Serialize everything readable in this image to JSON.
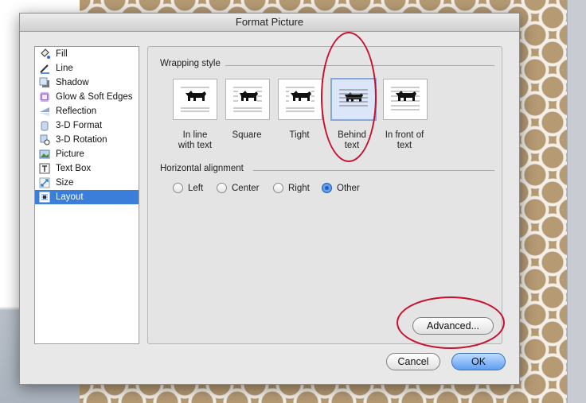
{
  "dialog": {
    "title": "Format Picture"
  },
  "sidebar": {
    "items": [
      {
        "label": "Fill",
        "icon": "fill-bucket-icon"
      },
      {
        "label": "Line",
        "icon": "line-pen-icon"
      },
      {
        "label": "Shadow",
        "icon": "shadow-icon"
      },
      {
        "label": "Glow & Soft Edges",
        "icon": "glow-icon"
      },
      {
        "label": "Reflection",
        "icon": "reflection-icon"
      },
      {
        "label": "3-D Format",
        "icon": "3d-format-icon"
      },
      {
        "label": "3-D Rotation",
        "icon": "3d-rotation-icon"
      },
      {
        "label": "Picture",
        "icon": "picture-icon"
      },
      {
        "label": "Text Box",
        "icon": "text-box-icon"
      },
      {
        "label": "Size",
        "icon": "size-icon"
      },
      {
        "label": "Layout",
        "icon": "layout-icon"
      }
    ],
    "selected": "Layout"
  },
  "wrapping": {
    "title": "Wrapping style",
    "options": [
      {
        "label_line1": "In line",
        "label_line2": "with text"
      },
      {
        "label_line1": "Square",
        "label_line2": ""
      },
      {
        "label_line1": "Tight",
        "label_line2": ""
      },
      {
        "label_line1": "Behind",
        "label_line2": "text"
      },
      {
        "label_line1": "In front of",
        "label_line2": "text"
      }
    ],
    "selected": "Behind text"
  },
  "alignment": {
    "title": "Horizontal alignment",
    "options": [
      "Left",
      "Center",
      "Right",
      "Other"
    ],
    "selected": "Other"
  },
  "buttons": {
    "advanced": "Advanced...",
    "cancel": "Cancel",
    "ok": "OK"
  },
  "colors": {
    "selection": "#3b7ed9",
    "annotation": "#c8102e",
    "ok_button": "#5f9ef0"
  }
}
